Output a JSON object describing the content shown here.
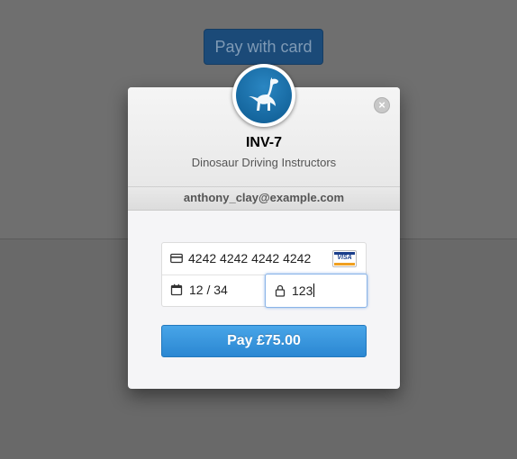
{
  "background_button": {
    "label": "Pay with card"
  },
  "modal": {
    "title": "INV-7",
    "subtitle": "Dinosaur Driving Instructors",
    "email": "anthony_clay@example.com",
    "close_icon": "close-icon",
    "logo_icon": "dinosaur-logo-icon"
  },
  "form": {
    "card_number": "4242 4242 4242 4242",
    "card_brand": "VISA",
    "expiry": "12 / 34",
    "cvc": "123",
    "card_icon": "credit-card-icon",
    "calendar_icon": "calendar-icon",
    "lock_icon": "lock-icon"
  },
  "pay_button": {
    "label": "Pay £75.00"
  },
  "colors": {
    "accent": "#2b87d2",
    "overlay": "#6b6b6b",
    "focus": "#8ab4e8"
  }
}
